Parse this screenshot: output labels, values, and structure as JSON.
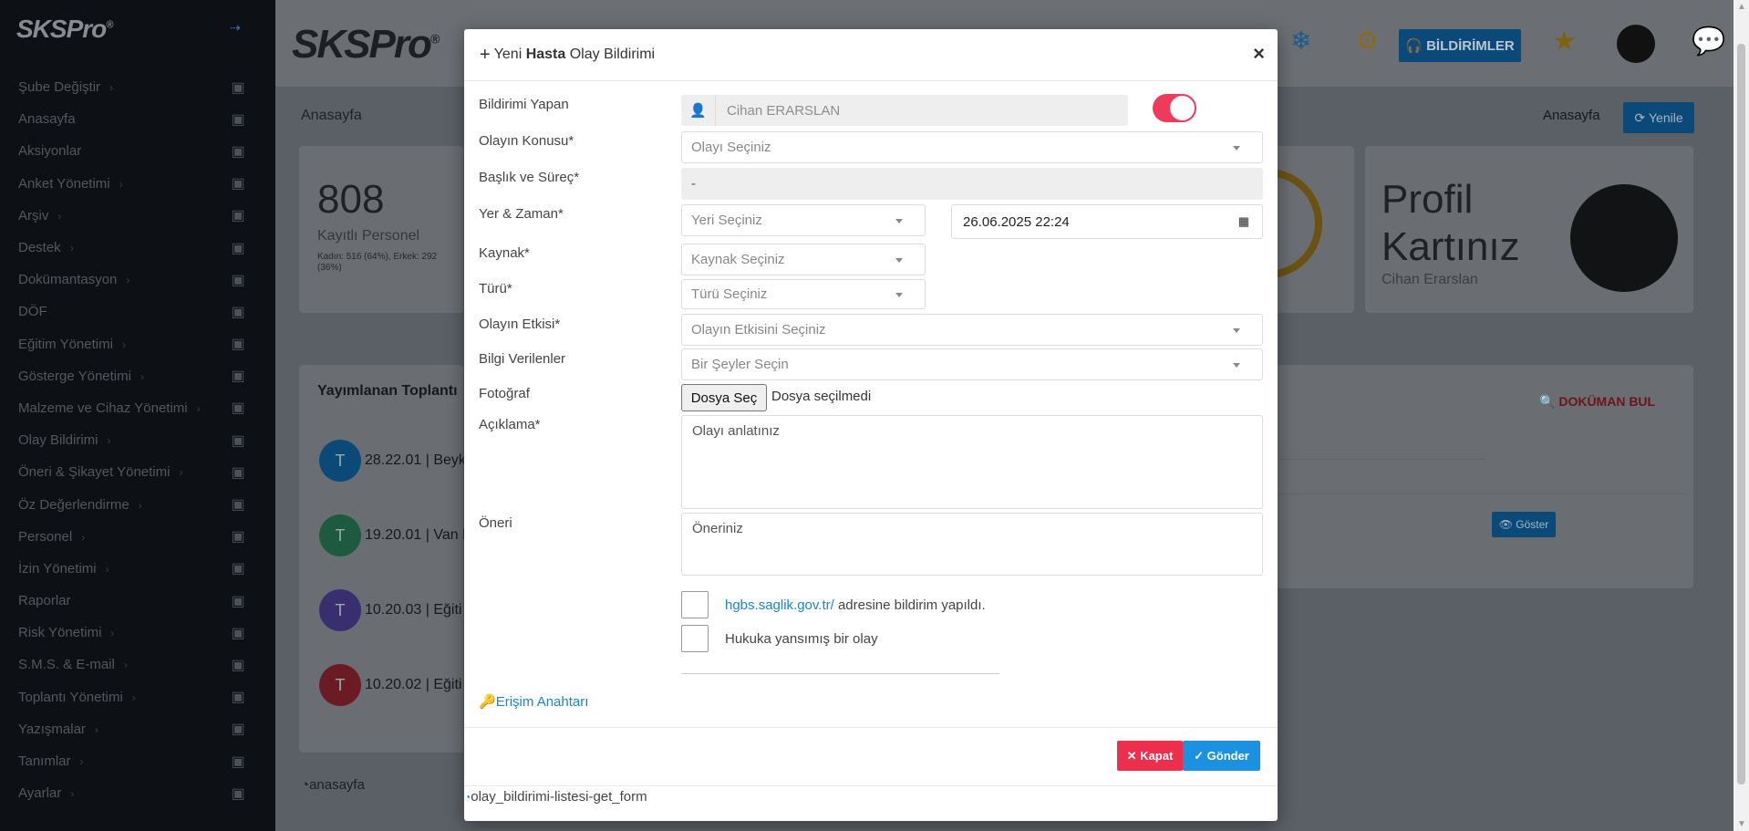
{
  "sidebar": {
    "logo": "SKSPro",
    "items": [
      {
        "label": "Şube Değiştir",
        "chev": true,
        "icon": "branch-icon"
      },
      {
        "label": "Anasayfa",
        "chev": false,
        "icon": "dashboard-icon"
      },
      {
        "label": "Aksiyonlar",
        "chev": false,
        "icon": "laptop-icon"
      },
      {
        "label": "Anket Yönetimi",
        "chev": true,
        "icon": "chart-icon"
      },
      {
        "label": "Arşiv",
        "chev": true,
        "icon": "archive-icon"
      },
      {
        "label": "Destek",
        "chev": true,
        "icon": "headset-icon"
      },
      {
        "label": "Dokümantasyon",
        "chev": true,
        "icon": "copy-icon"
      },
      {
        "label": "DÖF",
        "chev": false,
        "icon": "recycle-icon"
      },
      {
        "label": "Eğitim Yönetimi",
        "chev": true,
        "icon": "graduation-icon"
      },
      {
        "label": "Gösterge Yönetimi",
        "chev": true,
        "icon": "flag-icon"
      },
      {
        "label": "Malzeme ve Cihaz Yönetimi",
        "chev": true,
        "icon": "tags-icon"
      },
      {
        "label": "Olay Bildirimi",
        "chev": true,
        "icon": "hand-icon"
      },
      {
        "label": "Öneri & Şikayet Yönetimi",
        "chev": true,
        "icon": "wave-icon"
      },
      {
        "label": "Öz Değerlendirme",
        "chev": true,
        "icon": "calendar-check-icon"
      },
      {
        "label": "Personel",
        "chev": true,
        "icon": "users-icon"
      },
      {
        "label": "İzin Yönetimi",
        "chev": true,
        "icon": "calendar-icon"
      },
      {
        "label": "Raporlar",
        "chev": false,
        "icon": "list-icon"
      },
      {
        "label": "Risk Yönetimi",
        "chev": true,
        "icon": "warning-icon"
      },
      {
        "label": "S.M.S. & E-mail",
        "chev": true,
        "icon": "sms-icon"
      },
      {
        "label": "Toplantı Yönetimi",
        "chev": true,
        "icon": "comments-icon"
      },
      {
        "label": "Yazışmalar",
        "chev": true,
        "icon": "file-sign-icon"
      },
      {
        "label": "Tanımlar",
        "chev": true,
        "icon": "list-ul-icon"
      },
      {
        "label": "Ayarlar",
        "chev": true,
        "icon": "sitemap-icon"
      }
    ]
  },
  "header": {
    "logo": "SKSPro",
    "notifications_label": "BİLDİRİMLER"
  },
  "page": {
    "breadcrumb": "Anasayfa",
    "breadcrumb_right": "Anasayfa",
    "refresh_label": "Yenile",
    "stat_number": "808",
    "stat_label": "Kayıtlı Personel",
    "stat_sub": "Kadın: 516 (64%), Erkek: 292 (36%)",
    "profile_title_1": "Profil",
    "profile_title_2": "Kartınız",
    "profile_name": "Cihan Erarslan",
    "published_title": "Yayımlanan Toplantı",
    "doc_find_label": "DOKÜMAN BUL",
    "show_label": "Göster",
    "published_rows": [
      {
        "initial": "T",
        "text": "28.22.01 | Beyk",
        "color": "#0b4a78"
      },
      {
        "initial": "T",
        "text": "19.20.01 | Van K",
        "color": "#1e5a3f"
      },
      {
        "initial": "T",
        "text": "10.20.03 | Eğiti",
        "color": "#3a2f6e"
      },
      {
        "initial": "T",
        "text": "10.20.02 | Eğiti",
        "color": "#6b1b23"
      }
    ],
    "footer_link": "anasayfa"
  },
  "modal": {
    "title_prefix": "Yeni",
    "title_bold": "Hasta",
    "title_suffix": "Olay Bildirimi",
    "labels": {
      "reporter": "Bildirimi Yapan",
      "subject": "Olayın Konusu*",
      "title_process": "Başlık ve Süreç*",
      "place_time": "Yer & Zaman*",
      "source": "Kaynak*",
      "type": "Türü*",
      "effect": "Olayın Etkisi*",
      "informed": "Bilgi Verilenler",
      "photo": "Fotoğraf",
      "description": "Açıklama*",
      "suggestion": "Öneri"
    },
    "reporter_value": "Cihan ERARSLAN",
    "subject_placeholder": "Olayı Seçiniz",
    "title_process_value": "-",
    "place_placeholder": "Yeri Seçiniz",
    "datetime_value": "26.06.2025 22:24",
    "source_placeholder": "Kaynak Seçiniz",
    "type_placeholder": "Türü Seçiniz",
    "effect_placeholder": "Olayın Etkisini Seçiniz",
    "informed_placeholder": "Bir Şeyler Seçin",
    "file_button": "Dosya Seç",
    "file_status": "Dosya seçilmedi",
    "description_placeholder": "Olayı anlatınız",
    "suggestion_placeholder": "Öneriniz",
    "hgbs_link": "hgbs.saglik.gov.tr/",
    "hgbs_text": "adresine bildirim yapıldı.",
    "legal_text": "Hukuka yansımış bir olay",
    "access_key": "Erişim Anahtarı",
    "close_button": "Kapat",
    "send_button": "Gönder",
    "form_id": "olay_bildirimi-listesi-get_form",
    "toggle_on": true,
    "toggle_color": "#ef3b5b"
  }
}
